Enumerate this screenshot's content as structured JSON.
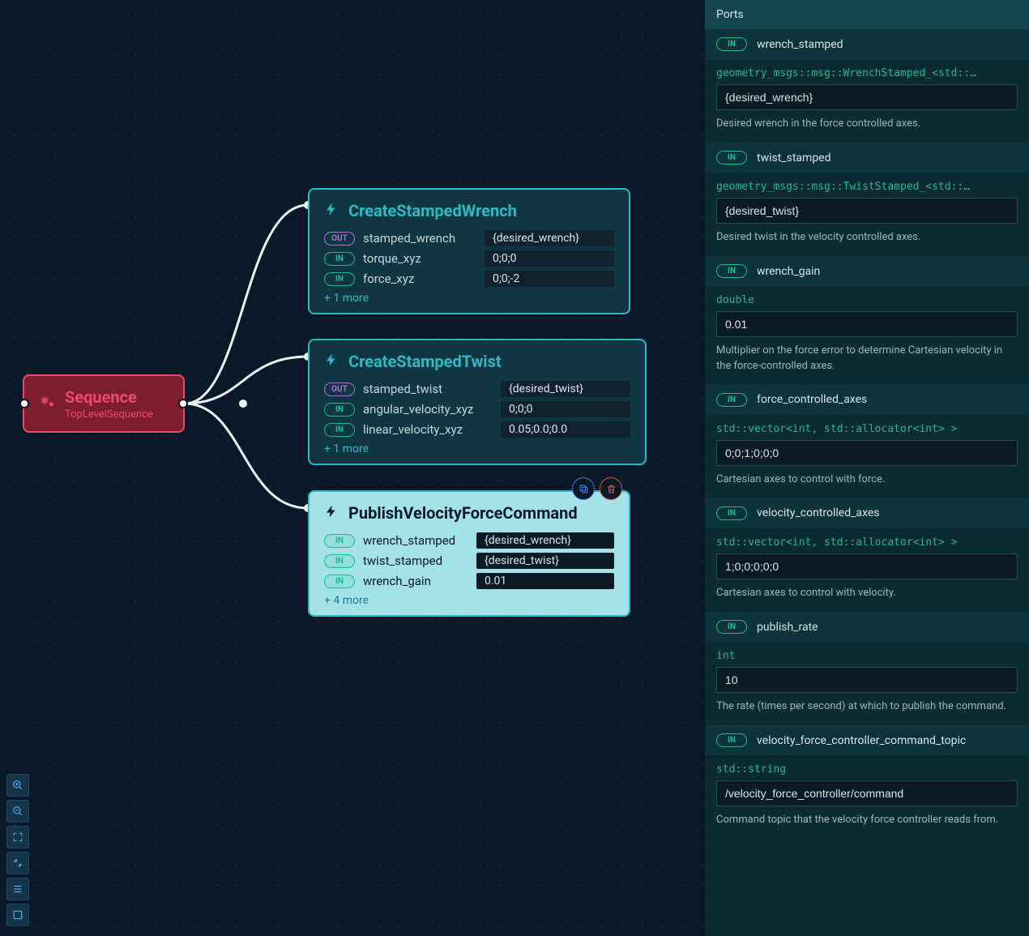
{
  "root": {
    "title": "Sequence",
    "subtitle": "TopLevelSequence"
  },
  "nodes": [
    {
      "id": "n1",
      "title": "CreateStampedWrench",
      "selected": false,
      "rows": [
        {
          "dir": "OUT",
          "label": "stamped_wrench",
          "value": "{desired_wrench}"
        },
        {
          "dir": "IN",
          "label": "torque_xyz",
          "value": "0;0;0"
        },
        {
          "dir": "IN",
          "label": "force_xyz",
          "value": "0;0;-2"
        }
      ],
      "more": "+ 1 more"
    },
    {
      "id": "n2",
      "title": "CreateStampedTwist",
      "selected": false,
      "rows": [
        {
          "dir": "OUT",
          "label": "stamped_twist",
          "value": "{desired_twist}"
        },
        {
          "dir": "IN",
          "label": "angular_velocity_xyz",
          "value": "0;0;0"
        },
        {
          "dir": "IN",
          "label": "linear_velocity_xyz",
          "value": "0.05;0.0;0.0"
        }
      ],
      "more": "+ 1 more"
    },
    {
      "id": "n3",
      "title": "PublishVelocityForceCommand",
      "selected": true,
      "rows": [
        {
          "dir": "IN",
          "label": "wrench_stamped",
          "value": "{desired_wrench}"
        },
        {
          "dir": "IN",
          "label": "twist_stamped",
          "value": "{desired_twist}"
        },
        {
          "dir": "IN",
          "label": "wrench_gain",
          "value": "0.01"
        }
      ],
      "more": "+ 4 more"
    }
  ],
  "panel": {
    "title": "Ports",
    "ports": [
      {
        "dir": "IN",
        "name": "wrench_stamped",
        "type": "geometry_msgs::msg::WrenchStamped_<std::…",
        "value": "{desired_wrench}",
        "desc": "Desired wrench in the force controlled axes."
      },
      {
        "dir": "IN",
        "name": "twist_stamped",
        "type": "geometry_msgs::msg::TwistStamped_<std::…",
        "value": "{desired_twist}",
        "desc": "Desired twist in the velocity controlled axes."
      },
      {
        "dir": "IN",
        "name": "wrench_gain",
        "type": "double",
        "value": "0.01",
        "desc": "Multiplier on the force error to determine Cartesian velocity in the force-controlled axes."
      },
      {
        "dir": "IN",
        "name": "force_controlled_axes",
        "type": "std::vector<int, std::allocator<int> >",
        "value": "0;0;1;0;0;0",
        "desc": "Cartesian axes to control with force."
      },
      {
        "dir": "IN",
        "name": "velocity_controlled_axes",
        "type": "std::vector<int, std::allocator<int> >",
        "value": "1;0;0;0;0;0",
        "desc": "Cartesian axes to control with velocity."
      },
      {
        "dir": "IN",
        "name": "publish_rate",
        "type": "int",
        "value": "10",
        "desc": "The rate (times per second) at which to publish the command."
      },
      {
        "dir": "IN",
        "name": "velocity_force_controller_command_topic",
        "type": "std::string",
        "value": "/velocity_force_controller/command",
        "desc": "Command topic that the velocity force controller reads from."
      }
    ]
  },
  "pill_labels": {
    "in": "IN",
    "out": "OUT"
  },
  "actions": {
    "copy": "⧉",
    "delete": "🗑"
  },
  "toolbar": {
    "zoom_in": "⊕",
    "zoom_out": "⊖",
    "fit": "⛶",
    "collapse": "⇲",
    "list": "≣",
    "fullscreen": "⛶"
  }
}
